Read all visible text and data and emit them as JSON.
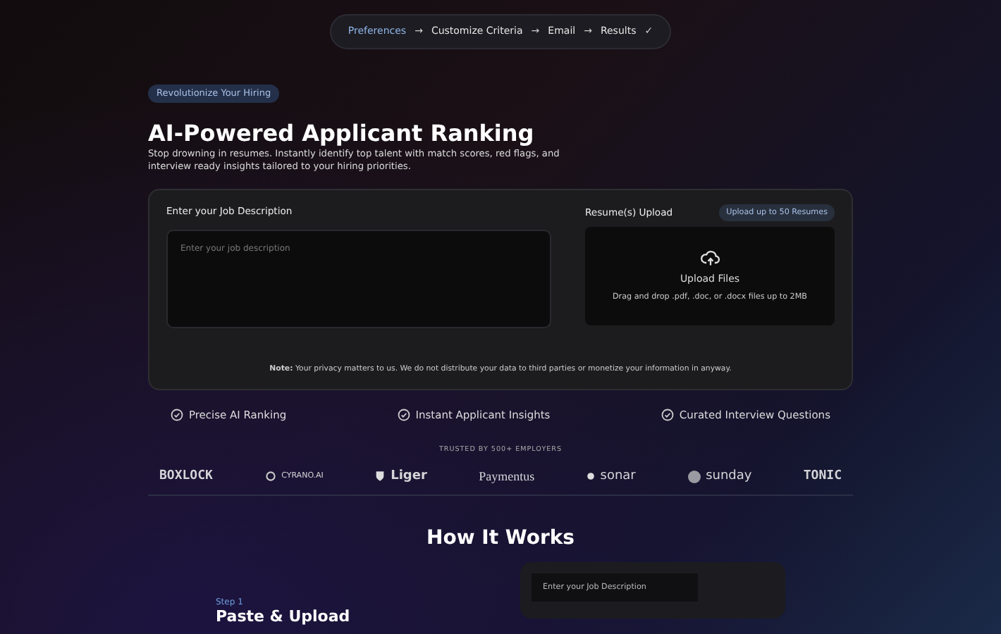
{
  "stepper": {
    "steps": [
      {
        "label": "Preferences",
        "selected": true,
        "arrow": "→"
      },
      {
        "label": "Customize Criteria",
        "selected": false,
        "arrow": "→"
      },
      {
        "label": "Email",
        "selected": false,
        "arrow": "→"
      },
      {
        "label": "Results",
        "selected": false,
        "check": "✓"
      }
    ]
  },
  "hero": {
    "badge": "Revolutionize Your Hiring",
    "title": "AI-Powered Applicant Ranking",
    "subtitle": "Stop drowning in resumes. Instantly identify top talent with match scores, red flags, and interview ready insights tailored to your hiring priorities."
  },
  "form_card": {
    "job_description": {
      "label": "Enter your Job Description",
      "placeholder": "Enter your job description"
    },
    "upload": {
      "label": "Resume(s) Upload",
      "limit_badge": "Upload up to 50 Resumes",
      "title": "Upload Files",
      "hint": "Drag and drop .pdf, .doc, or .docx files up to 2MB"
    },
    "note": "**Note:** Your privacy matters to us. We do not distribute your data to third parties or monetize your information in anyway."
  },
  "features": [
    "Precise AI Ranking",
    "Instant Applicant Insights",
    "Curated Interview Questions"
  ],
  "trusted": {
    "label": "TRUSTED BY 500+ EMPLOYERS",
    "logos": [
      {
        "name": "BOXLOCK",
        "kind": "mono"
      },
      {
        "name": "CYRANO.AI",
        "kind": "ring"
      },
      {
        "name": "Liger",
        "kind": "shield"
      },
      {
        "name": "Paymentus",
        "kind": "serif"
      },
      {
        "name": "sonar",
        "kind": "dot"
      },
      {
        "name": "sunday",
        "kind": "disc"
      },
      {
        "name": "TONIC",
        "kind": "mono"
      }
    ]
  },
  "how_it_works": {
    "title": "How It Works",
    "step_label": "Step 1",
    "step_title": "Paste & Upload",
    "preview_label": "Enter your Job Description"
  }
}
